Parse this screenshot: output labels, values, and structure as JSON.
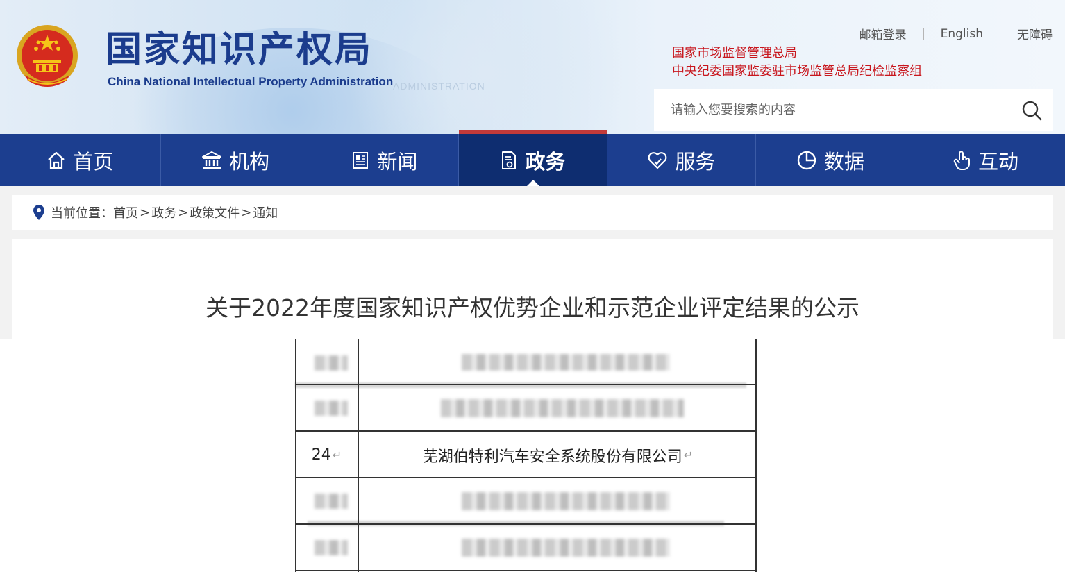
{
  "header": {
    "site_title": "国家知识产权局",
    "site_subtitle": "China National Intellectual Property Administration",
    "watermark_text": "ADMINISTRATION",
    "top_links": [
      "邮箱登录",
      "English",
      "无障碍"
    ],
    "affiliates": [
      "国家市场监督管理总局",
      "中央纪委国家监委驻市场监管总局纪检监察组"
    ],
    "search": {
      "placeholder": "请输入您要搜索的内容",
      "value": ""
    }
  },
  "nav": {
    "items": [
      {
        "label": "首页",
        "icon": "home-icon"
      },
      {
        "label": "机构",
        "icon": "institution-icon"
      },
      {
        "label": "新闻",
        "icon": "news-icon"
      },
      {
        "label": "政务",
        "icon": "document-icon",
        "active": true
      },
      {
        "label": "服务",
        "icon": "heart-hand-icon"
      },
      {
        "label": "数据",
        "icon": "pie-chart-icon"
      },
      {
        "label": "互动",
        "icon": "touch-icon"
      }
    ],
    "background_color": "#1c3e8f",
    "active_color": "#0e2d70",
    "accent_color": "#c13a3a"
  },
  "breadcrumb": {
    "prefix": "当前位置：",
    "items": [
      "首页",
      "政务",
      "政策文件",
      "通知"
    ],
    "separator": ">"
  },
  "article": {
    "title": "关于2022年度国家知识产权优势企业和示范企业评定结果的公示"
  },
  "table": {
    "rows": [
      {
        "no": "",
        "name": "",
        "blurred": true
      },
      {
        "no": "",
        "name": "",
        "blurred": true
      },
      {
        "no": "24",
        "name": "芜湖伯特利汽车安全系统股份有限公司",
        "blurred": false
      },
      {
        "no": "",
        "name": "",
        "blurred": true
      },
      {
        "no": "",
        "name": "",
        "blurred": true
      }
    ],
    "return_mark": "↵"
  }
}
